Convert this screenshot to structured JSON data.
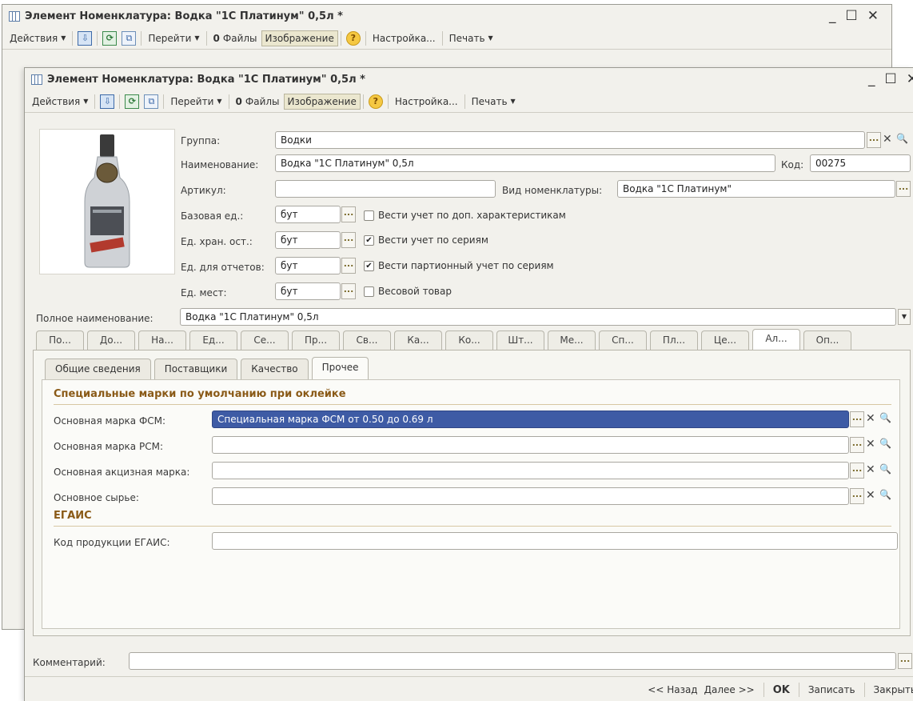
{
  "window": {
    "title": "Элемент Номенклатура: Водка \"1С Платинум\" 0,5л *"
  },
  "toolbar": {
    "actions": "Действия",
    "goto": "Перейти",
    "files": "Файлы",
    "image": "Изображение",
    "settings": "Настройка...",
    "print": "Печать"
  },
  "form": {
    "group_label": "Группа:",
    "group_value": "Водки",
    "name_label": "Наименование:",
    "name_value": "Водка \"1С Платинум\" 0,5л",
    "code_label": "Код:",
    "code_value": "00275",
    "article_label": "Артикул:",
    "article_value": "",
    "kind_label": "Вид номенклатуры:",
    "kind_value": "Водка \"1С Платинум\"",
    "base_unit_label": "Базовая ед.:",
    "base_unit_value": "бут",
    "store_unit_label": "Ед. хран. ост.:",
    "store_unit_value": "бут",
    "report_unit_label": "Ед. для отчетов:",
    "report_unit_value": "бут",
    "place_unit_label": "Ед. мест:",
    "place_unit_value": "бут",
    "chk_characteristics": {
      "label": "Вести учет по доп. характеристикам",
      "checked": false
    },
    "chk_series": {
      "label": "Вести учет по сериям",
      "checked": true
    },
    "chk_batch": {
      "label": "Вести партионный учет по сериям",
      "checked": true
    },
    "chk_weight": {
      "label": "Весовой товар",
      "checked": false
    },
    "full_name_label": "Полное наименование:",
    "full_name_value": "Водка \"1С Платинум\" 0,5л"
  },
  "main_tabs": [
    "По...",
    "До...",
    "На...",
    "Ед...",
    "Се...",
    "Пр...",
    "Св...",
    "Ка...",
    "Ко...",
    "Шт...",
    "Ме...",
    "Сп...",
    "Пл...",
    "Це...",
    "Ал...",
    "Оп..."
  ],
  "main_tab_active": 14,
  "sub_tabs": [
    "Общие сведения",
    "Поставщики",
    "Качество",
    "Прочее"
  ],
  "sub_tab_active": 3,
  "special": {
    "section_title": "Специальные марки по умолчанию при оклейке",
    "fsm_label": "Основная марка ФСМ:",
    "fsm_value": "Специальная марка ФСМ от 0.50 до 0.69 л",
    "rsm_label": "Основная марка РСМ:",
    "rsm_value": "",
    "excise_label": "Основная акцизная марка:",
    "excise_value": "",
    "raw_label": "Основное сырье:",
    "raw_value": "",
    "egais_title": "ЕГАИС",
    "egais_code_label": "Код продукции ЕГАИС:",
    "egais_code_value": ""
  },
  "comment": {
    "label": "Комментарий:",
    "value": ""
  },
  "footer": {
    "back": "<< Назад",
    "next": "Далее >>",
    "ok": "OK",
    "save": "Записать",
    "close": "Закрыть"
  }
}
